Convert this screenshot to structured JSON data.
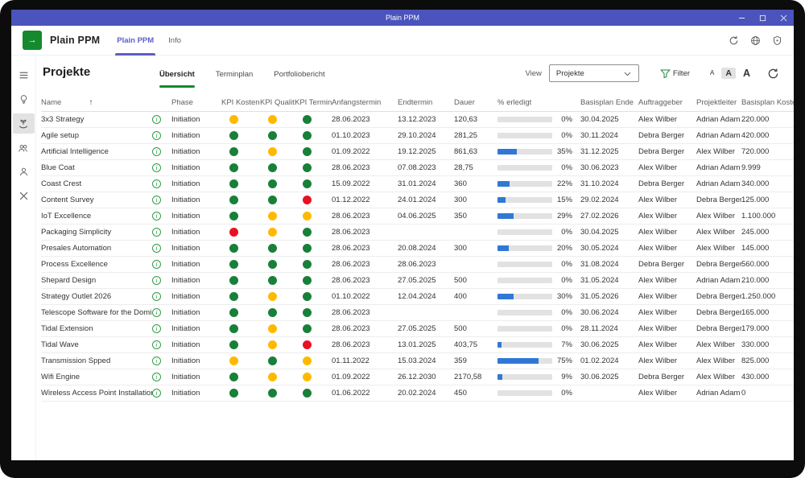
{
  "colors": {
    "titlebar": "#4b53bc",
    "accent_purple": "#5b5fc7",
    "accent_green": "#15892e",
    "progress_blue": "#3178d6",
    "kpi": {
      "green": "#188038",
      "yellow": "#ffb900",
      "red": "#e81123"
    }
  },
  "titlebar": {
    "title": "Plain PPM",
    "controls": [
      "minimize",
      "maximize",
      "close"
    ]
  },
  "app_header": {
    "app_name": "Plain PPM",
    "tabs": [
      {
        "label": "Plain PPM",
        "active": true
      },
      {
        "label": "Info",
        "active": false
      }
    ],
    "icons": [
      "refresh-icon",
      "globe-icon",
      "shield-icon"
    ]
  },
  "sidebar": {
    "items": [
      {
        "icon": "menu-icon",
        "selected": false
      },
      {
        "icon": "lightbulb-icon",
        "selected": false
      },
      {
        "icon": "sprout-hand-icon",
        "selected": true
      },
      {
        "icon": "team-icon",
        "selected": false
      },
      {
        "icon": "person-icon",
        "selected": false
      },
      {
        "icon": "tools-icon",
        "selected": false
      }
    ]
  },
  "toolbar": {
    "page_title": "Projekte",
    "tabs": [
      "Übersicht",
      "Terminplan",
      "Portfoliobericht"
    ],
    "active_tab": "Übersicht",
    "view_label": "View",
    "view_value": "Projekte",
    "filter_label": "Filter",
    "font_sizes": [
      "A",
      "A",
      "A"
    ]
  },
  "table": {
    "columns": [
      "Name",
      "Phase",
      "KPI Kosten",
      "KPI Qualität",
      "KPI Termine",
      "Anfangstermin",
      "Endtermin",
      "Dauer",
      "% erledigt",
      "Basisplan Ende",
      "Auftraggeber",
      "Projektleiter",
      "Basisplan Kosten (G"
    ],
    "sort_icon": "↑",
    "rows": [
      {
        "name": "3x3 Strategy",
        "phase": "Initiation",
        "kpi": [
          "yellow",
          "yellow",
          "green"
        ],
        "start": "28.06.2023",
        "end": "13.12.2023",
        "dauer": "120,63",
        "percent": 0,
        "percent_label": "0%",
        "baseline_end": "30.04.2025",
        "auftraggeber": "Alex Wilber",
        "projektleiter": "Adrian Adam",
        "kosten": "220.000"
      },
      {
        "name": "Agile setup",
        "phase": "Initiation",
        "kpi": [
          "green",
          "green",
          "green"
        ],
        "start": "01.10.2023",
        "end": "29.10.2024",
        "dauer": "281,25",
        "percent": 0,
        "percent_label": "0%",
        "baseline_end": "30.11.2024",
        "auftraggeber": "Debra Berger",
        "projektleiter": "Adrian Adam",
        "kosten": "420.000"
      },
      {
        "name": "Artificial Intelligence",
        "phase": "Initiation",
        "kpi": [
          "green",
          "yellow",
          "green"
        ],
        "start": "01.09.2022",
        "end": "19.12.2025",
        "dauer": "861,63",
        "percent": 35,
        "percent_label": "35%",
        "baseline_end": "31.12.2025",
        "auftraggeber": "Debra Berger",
        "projektleiter": "Alex Wilber",
        "kosten": "720.000"
      },
      {
        "name": "Blue Coat",
        "phase": "Initiation",
        "kpi": [
          "green",
          "green",
          "green"
        ],
        "start": "28.06.2023",
        "end": "07.08.2023",
        "dauer": "28,75",
        "percent": 0,
        "percent_label": "0%",
        "baseline_end": "30.06.2023",
        "auftraggeber": "Alex Wilber",
        "projektleiter": "Adrian Adam",
        "kosten": "9.999"
      },
      {
        "name": "Coast Crest",
        "phase": "Initiation",
        "kpi": [
          "green",
          "green",
          "green"
        ],
        "start": "15.09.2022",
        "end": "31.01.2024",
        "dauer": "360",
        "percent": 22,
        "percent_label": "22%",
        "baseline_end": "31.10.2024",
        "auftraggeber": "Debra Berger",
        "projektleiter": "Adrian Adam",
        "kosten": "340.000"
      },
      {
        "name": "Content Survey",
        "phase": "Initiation",
        "kpi": [
          "green",
          "green",
          "red"
        ],
        "start": "01.12.2022",
        "end": "24.01.2024",
        "dauer": "300",
        "percent": 15,
        "percent_label": "15%",
        "baseline_end": "29.02.2024",
        "auftraggeber": "Alex Wilber",
        "projektleiter": "Debra Berger",
        "kosten": "125.000"
      },
      {
        "name": "IoT Excellence",
        "phase": "Initiation",
        "kpi": [
          "green",
          "yellow",
          "yellow"
        ],
        "start": "28.06.2023",
        "end": "04.06.2025",
        "dauer": "350",
        "percent": 29,
        "percent_label": "29%",
        "baseline_end": "27.02.2026",
        "auftraggeber": "Alex Wilber",
        "projektleiter": "Alex Wilber",
        "kosten": "1.100.000"
      },
      {
        "name": "Packaging Simplicity",
        "phase": "Initiation",
        "kpi": [
          "red",
          "yellow",
          "green"
        ],
        "start": "28.06.2023",
        "end": "",
        "dauer": "",
        "percent": 0,
        "percent_label": "0%",
        "baseline_end": "30.04.2025",
        "auftraggeber": "Alex Wilber",
        "projektleiter": "Alex Wilber",
        "kosten": "245.000"
      },
      {
        "name": "Presales Automation",
        "phase": "Initiation",
        "kpi": [
          "green",
          "green",
          "green"
        ],
        "start": "28.06.2023",
        "end": "20.08.2024",
        "dauer": "300",
        "percent": 20,
        "percent_label": "20%",
        "baseline_end": "30.05.2024",
        "auftraggeber": "Alex Wilber",
        "projektleiter": "Alex Wilber",
        "kosten": "145.000"
      },
      {
        "name": "Process Excellence",
        "phase": "Initiation",
        "kpi": [
          "green",
          "green",
          "green"
        ],
        "start": "28.06.2023",
        "end": "28.06.2023",
        "dauer": "",
        "percent": 0,
        "percent_label": "0%",
        "baseline_end": "31.08.2024",
        "auftraggeber": "Debra Berger",
        "projektleiter": "Debra Berger",
        "kosten": "560.000"
      },
      {
        "name": "Shepard Design",
        "phase": "Initiation",
        "kpi": [
          "green",
          "green",
          "green"
        ],
        "start": "28.06.2023",
        "end": "27.05.2025",
        "dauer": "500",
        "percent": 0,
        "percent_label": "0%",
        "baseline_end": "31.05.2024",
        "auftraggeber": "Alex Wilber",
        "projektleiter": "Adrian Adam",
        "kosten": "210.000"
      },
      {
        "name": "Strategy Outlet 2026",
        "phase": "Initiation",
        "kpi": [
          "green",
          "yellow",
          "green"
        ],
        "start": "01.10.2022",
        "end": "12.04.2024",
        "dauer": "400",
        "percent": 30,
        "percent_label": "30%",
        "baseline_end": "31.05.2026",
        "auftraggeber": "Alex Wilber",
        "projektleiter": "Debra Berger",
        "kosten": "1.250.000"
      },
      {
        "name": "Telescope Software for the Dominion",
        "phase": "Initiation",
        "kpi": [
          "green",
          "green",
          "green"
        ],
        "start": "28.06.2023",
        "end": "",
        "dauer": "",
        "percent": 0,
        "percent_label": "0%",
        "baseline_end": "30.06.2024",
        "auftraggeber": "Alex Wilber",
        "projektleiter": "Debra Berger",
        "kosten": "165.000"
      },
      {
        "name": "Tidal Extension",
        "phase": "Initiation",
        "kpi": [
          "green",
          "yellow",
          "green"
        ],
        "start": "28.06.2023",
        "end": "27.05.2025",
        "dauer": "500",
        "percent": 0,
        "percent_label": "0%",
        "baseline_end": "28.11.2024",
        "auftraggeber": "Alex Wilber",
        "projektleiter": "Debra Berger",
        "kosten": "179.000"
      },
      {
        "name": "Tidal Wave",
        "phase": "Initiation",
        "kpi": [
          "green",
          "yellow",
          "red"
        ],
        "start": "28.06.2023",
        "end": "13.01.2025",
        "dauer": "403,75",
        "percent": 7,
        "percent_label": "7%",
        "baseline_end": "30.06.2025",
        "auftraggeber": "Alex Wilber",
        "projektleiter": "Alex Wilber",
        "kosten": "330.000"
      },
      {
        "name": "Transmission Spped",
        "phase": "Initiation",
        "kpi": [
          "yellow",
          "green",
          "yellow"
        ],
        "start": "01.11.2022",
        "end": "15.03.2024",
        "dauer": "359",
        "percent": 75,
        "percent_label": "75%",
        "baseline_end": "01.02.2024",
        "auftraggeber": "Alex Wilber",
        "projektleiter": "Alex Wilber",
        "kosten": "825.000"
      },
      {
        "name": "Wifi Engine",
        "phase": "Initiation",
        "kpi": [
          "green",
          "yellow",
          "yellow"
        ],
        "start": "01.09.2022",
        "end": "26.12.2030",
        "dauer": "2170,58",
        "percent": 9,
        "percent_label": "9%",
        "baseline_end": "30.06.2025",
        "auftraggeber": "Debra Berger",
        "projektleiter": "Alex Wilber",
        "kosten": "430.000"
      },
      {
        "name": "Wireless Access Point Installation",
        "phase": "Initiation",
        "kpi": [
          "green",
          "green",
          "green"
        ],
        "start": "01.06.2022",
        "end": "20.02.2024",
        "dauer": "450",
        "percent": 0,
        "percent_label": "0%",
        "baseline_end": "",
        "auftraggeber": "Alex Wilber",
        "projektleiter": "Adrian Adam",
        "kosten": "0"
      }
    ]
  }
}
